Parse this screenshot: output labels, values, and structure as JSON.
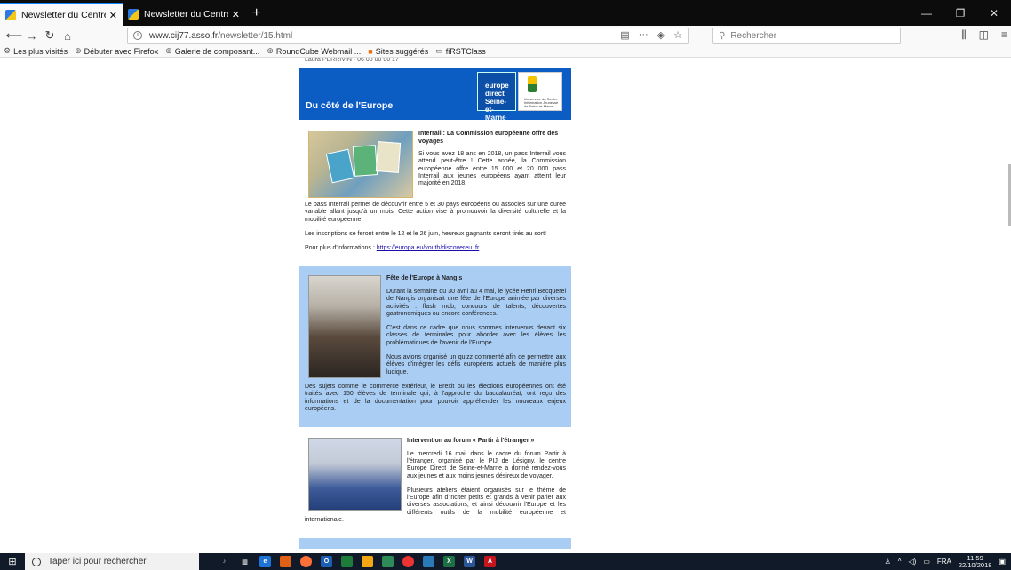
{
  "browser": {
    "tabs": [
      {
        "title": "Newsletter du Centre Informati",
        "active": true
      },
      {
        "title": "Newsletter du Centre Informati",
        "active": false
      }
    ],
    "url_host": "www.cij77.asso.fr",
    "url_path": "/newsletter/15.html",
    "search_placeholder": "Rechercher",
    "url_more": "···"
  },
  "bookmarks": [
    {
      "label": "Les plus visités",
      "icon": "gear-icon"
    },
    {
      "label": "Débuter avec Firefox",
      "icon": "globe-icon"
    },
    {
      "label": "Galerie de composant...",
      "icon": "globe-icon"
    },
    {
      "label": "RoundCube Webmail ...",
      "icon": "globe-icon"
    },
    {
      "label": "Sites suggérés",
      "icon": "orange-square-icon"
    },
    {
      "label": "fiRSTClass",
      "icon": "folder-icon"
    }
  ],
  "newsletter": {
    "cut_text": "Laura PERRIVIN · 06 00 00 00 17",
    "banner_title": "Du côté de l'Europe",
    "logo1_text": "europe direct Seine-et-Marne",
    "logo2_text": "Un service du Centre Information Jeunesse de Seine-et-Marne",
    "articles": [
      {
        "title": "Interrail : La Commission européenne offre des voyages",
        "p1": "Si vous avez 18 ans en 2018, un pass Interrail vous attend peut-être ! Cette année, la Commission européenne offre entre 15 000 et 20 000 pass Interrail aux jeunes européens ayant atteint leur majorité en 2018.",
        "p2": "Le pass Interrail permet de découvrir entre 5 et 30 pays européens ou associés sur une durée variable allant jusqu'à un mois. Cette action vise à promouvoir la diversité culturelle et la mobilité européenne.",
        "p3": "Les inscriptions se feront entre le 12 et le 26 juin, heureux gagnants seront tirés au sort!",
        "p4_prefix": "Pour plus d'informations : ",
        "link": "https://europa.eu/youth/discovereu_fr"
      },
      {
        "title": "Fête de l'Europe à Nangis",
        "p1": "Durant la semaine du 30 avril au 4 mai, le lycée Henri Becquerel de Nangis organisait une fête de l'Europe animée par diverses activités : flash mob, concours de talents, découvertes gastronomiques ou encore conférences.",
        "p2": "C'est dans ce cadre que nous sommes intervenus devant six classes de terminales pour aborder avec les élèves les problématiques de l'avenir de l'Europe.",
        "p3": "Nous avions organisé un quizz commenté afin de permettre aux élèves d'intégrer les défis européens actuels de manière plus ludique.",
        "p4": "Des sujets comme le commerce extérieur, le Brexit ou les élections européennes ont été traités avec 150 élèves de terminale qui, à l'approche du baccalauréat, ont reçu des informations et de la documentation pour pouvoir appréhender les nouveaux enjeux européens."
      },
      {
        "title": "Intervention au forum « Partir à l'étranger »",
        "p1": "Le mercredi 16 mai, dans le cadre du forum Partir à l'étranger, organisé par le PIJ de Lésigny, le centre Europe Direct de Seine-et-Marne a donné rendez-vous aux jeunes et aux moins jeunes désireux de voyager.",
        "p2": "Plusieurs ateliers étaient organisés sur le thème de l'Europe afin d'inciter petits et grands à venir parler aux diverses associations, et ainsi découvrir l'Europe et les différents outils de la mobilité européenne et internationale."
      }
    ]
  },
  "taskbar": {
    "search_placeholder": "Taper ici pour rechercher",
    "language": "FRA",
    "time": "11:59",
    "date": "22/10/2018"
  }
}
